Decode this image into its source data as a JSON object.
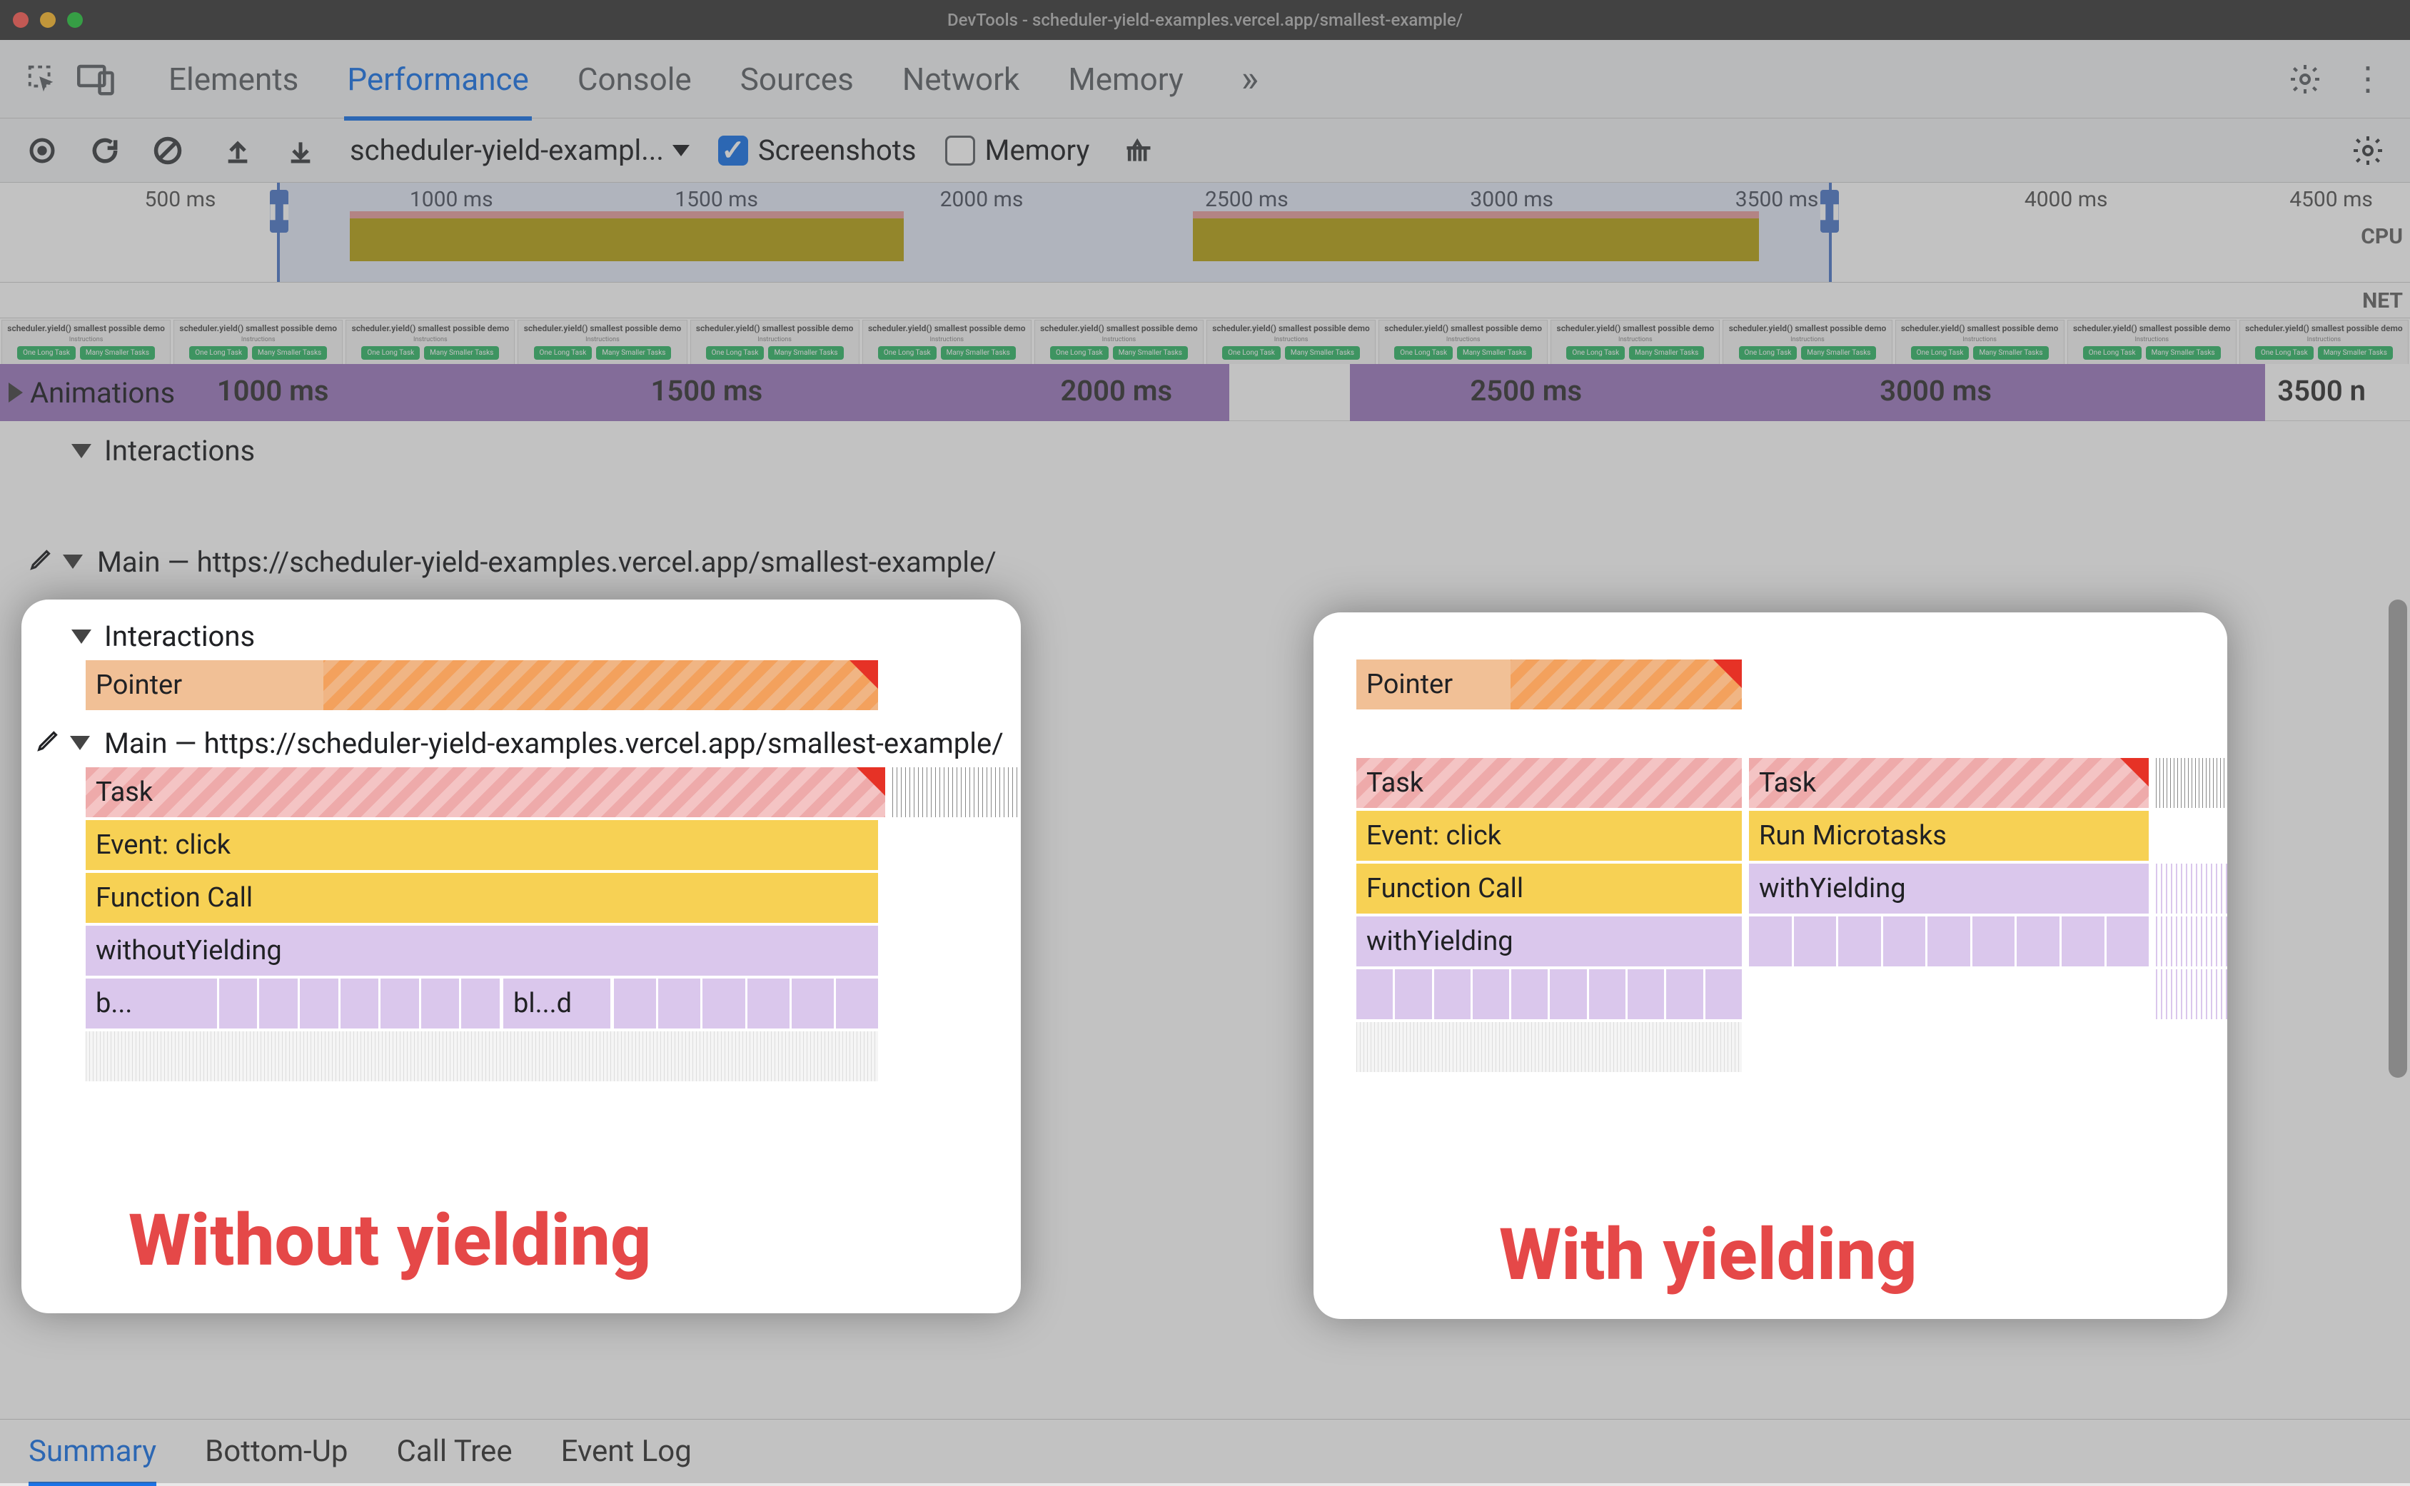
{
  "window": {
    "title": "DevTools - scheduler-yield-examples.vercel.app/smallest-example/"
  },
  "tabs": {
    "items": [
      "Elements",
      "Performance",
      "Console",
      "Sources",
      "Network",
      "Memory"
    ],
    "activeIndex": 1
  },
  "perfToolbar": {
    "dropdown": "scheduler-yield-exampl...",
    "screenshots": {
      "label": "Screenshots",
      "checked": true
    },
    "memory": {
      "label": "Memory",
      "checked": false
    }
  },
  "overview": {
    "ticks": [
      {
        "label": "500 ms",
        "pct": 6
      },
      {
        "label": "1000 ms",
        "pct": 17
      },
      {
        "label": "1500 ms",
        "pct": 28
      },
      {
        "label": "2000 ms",
        "pct": 39
      },
      {
        "label": "2500 ms",
        "pct": 50
      },
      {
        "label": "3000 ms",
        "pct": 61
      },
      {
        "label": "3500 ms",
        "pct": 72
      },
      {
        "label": "4000 ms",
        "pct": 84
      },
      {
        "label": "4500 ms",
        "pct": 95
      }
    ],
    "cpuLabel": "CPU",
    "netLabel": "NET",
    "selection": {
      "leftPct": 11.5,
      "rightPct": 76
    },
    "cpuBlocks": [
      {
        "leftPct": 14.5,
        "widthPct": 23
      },
      {
        "leftPct": 49.5,
        "widthPct": 23.5
      }
    ]
  },
  "filmstrip": {
    "thumbTitle": "scheduler.yield() smallest possible demo",
    "btn1": "One Long Task",
    "btn2": "Many Smaller Tasks",
    "count": 14
  },
  "ruler2": {
    "ticks": [
      {
        "label": "1000 ms",
        "pct": 9
      },
      {
        "label": "1500 ms",
        "pct": 27
      },
      {
        "label": "2000 ms",
        "pct": 44
      },
      {
        "label": "2500 ms",
        "pct": 61
      },
      {
        "label": "3000 ms",
        "pct": 78
      },
      {
        "label": "3500 n",
        "pct": 94.5
      }
    ],
    "animations": "Animations"
  },
  "interactions": {
    "header": "Interactions",
    "pointer": "Pointer"
  },
  "mainThread": {
    "header": "Main — https://scheduler-yield-examples.vercel.app/smallest-example/"
  },
  "flame": {
    "task": "Task",
    "eventClick": "Event: click",
    "functionCall": "Function Call",
    "withoutYielding": "withoutYielding",
    "withYielding": "withYielding",
    "runMicrotasks": "Run Microtasks",
    "bTrunc": "b...",
    "blTrunc": "bl...d"
  },
  "annotations": {
    "without": "Without yielding",
    "with": "With yielding"
  },
  "bottomTabs": {
    "items": [
      "Summary",
      "Bottom-Up",
      "Call Tree",
      "Event Log"
    ],
    "activeIndex": 0
  },
  "colors": {
    "accent": "#1a73e8",
    "flameOrange": "#f3a15d",
    "flameYellow": "#f7d154",
    "flamePurple": "#dac7ec",
    "flamePink": "#f4b7b7",
    "redCorner": "#e63226",
    "annotation": "#e54848"
  }
}
